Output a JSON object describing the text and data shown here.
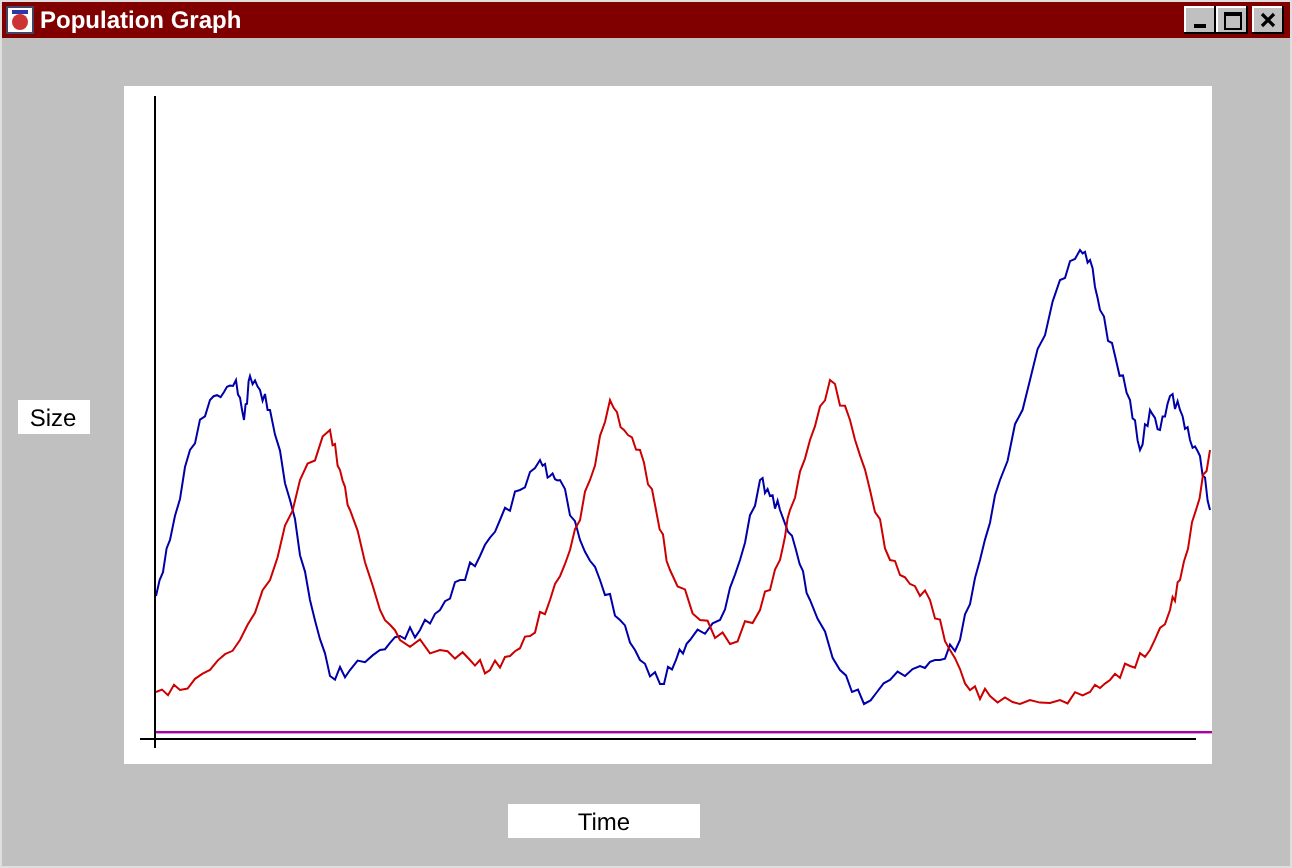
{
  "window": {
    "title": "Population Graph"
  },
  "chart": {
    "y_label": "Size",
    "x_label": "Time",
    "lines": [
      {
        "color": "#0000aa"
      },
      {
        "color": "#cc0000"
      },
      {
        "color": "#aa00aa"
      }
    ]
  }
}
